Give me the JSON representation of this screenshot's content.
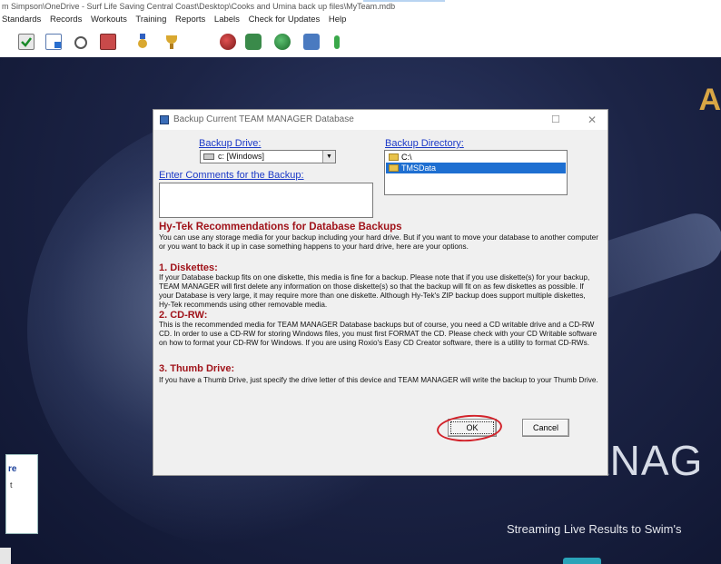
{
  "window": {
    "title": "m Simpson\\OneDrive - Surf Life Saving Central Coast\\Desktop\\Cooks and Umina back up files\\MyTeam.mdb"
  },
  "menu": {
    "items": [
      "Standards",
      "Records",
      "Workouts",
      "Training",
      "Reports",
      "Labels",
      "Check for Updates",
      "Help"
    ]
  },
  "toolbar": {
    "icons": [
      "check-icon",
      "document-icon",
      "stopwatch-icon",
      "calendar-icon",
      "medal-icon",
      "trophy-icon",
      "globe-icon",
      "people-icon",
      "globe-check-icon",
      "people-transfer-icon",
      "sprout-icon"
    ]
  },
  "background": {
    "brand_mark": "A",
    "brand_text": "ANAG",
    "tagline": "Streaming Live Results to Swim's",
    "left_card_line1": "re",
    "left_card_line2": "t"
  },
  "dialog": {
    "title": "Backup Current TEAM MANAGER Database",
    "max_glyph": "☐",
    "close_glyph": "✕",
    "backup_drive_label": "Backup Drive:",
    "backup_drive_value": "c: [Windows]",
    "backup_directory_label": "Backup Directory:",
    "directory_items": [
      {
        "label": "C:\\",
        "selected": false
      },
      {
        "label": "TMSData",
        "selected": true
      }
    ],
    "comments_label": "Enter Comments for the Backup:",
    "comments_value": "",
    "rec_heading": "Hy-Tek Recommendations for Database Backups",
    "rec_intro": "You can use any storage media for your backup including your hard drive.  But if you want to move your database to another computer or you want to back it up in case something happens to your hard drive, here are your options.",
    "sections": [
      {
        "heading": "1.  Diskettes:",
        "text": "If your Database backup fits on one diskette, this media is fine for a backup.  Please note that if you use diskette(s) for your backup, TEAM MANAGER will first delete any information on those diskette(s) so that the backup will fit on as few diskettes as possible.  If your Database is very large, it may require more than one diskette.  Although Hy-Tek's ZIP backup does support multiple diskettes, Hy-Tek recommends using other removable media."
      },
      {
        "heading": "2. CD-RW:",
        "text": "This is the recommended media for TEAM MANAGER Database backups but of course, you need a CD writable drive and a CD-RW CD.  In order to use a CD-RW for storing Windows files, you must first FORMAT the CD.  Please check with your CD Writable software on how to format your CD-RW for Windows.  If you are using Roxio's Easy CD Creator software, there is a utility to format CD-RWs."
      },
      {
        "heading": "3. Thumb Drive:",
        "text": "If you have a Thumb Drive, just specify the drive letter of this device and TEAM MANAGER will write the backup to your Thumb Drive."
      }
    ],
    "ok_label": "OK",
    "cancel_label": "Cancel"
  },
  "colors": {
    "link_blue": "#1b39c7",
    "heading_red": "#a0131a",
    "selection_blue": "#1e6fd1",
    "annotation_red": "#d2222a"
  }
}
